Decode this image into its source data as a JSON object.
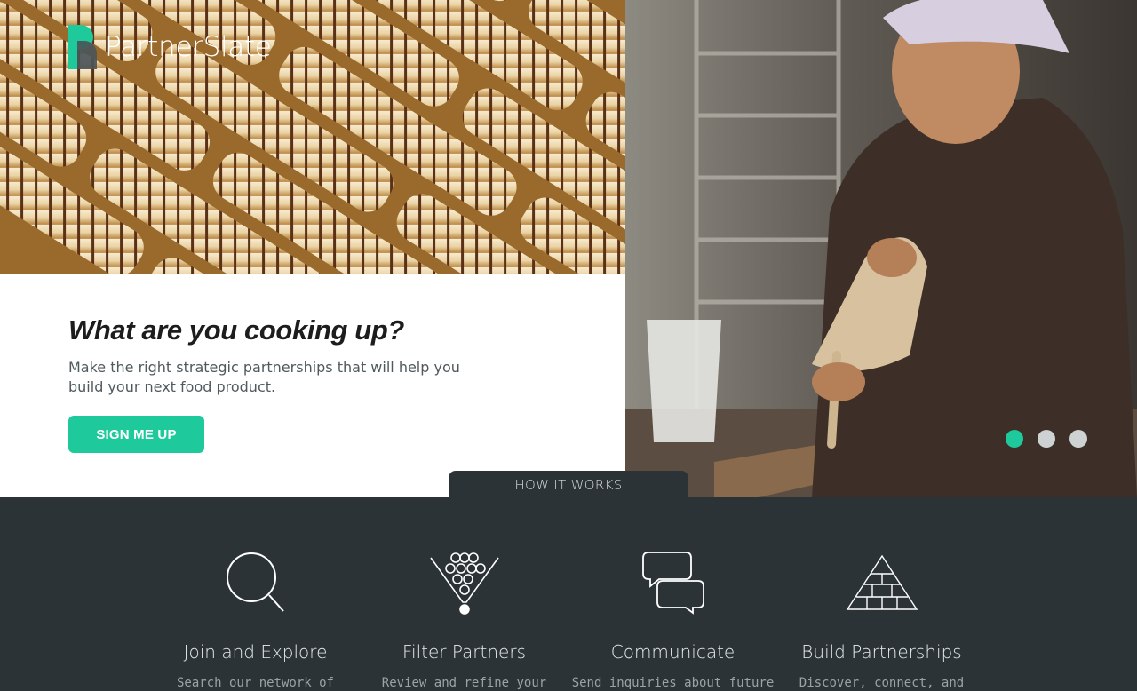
{
  "brand": {
    "name": "PartnerSlate",
    "accent": "#1ec99b",
    "dark": "#2c3337"
  },
  "hero": {
    "headline": "What are you cooking up?",
    "subcopy": "Make the right strategic partnerships that will help you build your next food product.",
    "cta_label": "SIGN ME UP",
    "carousel": {
      "slides": 3,
      "active": 1
    }
  },
  "how": {
    "tab_label": "HOW IT WORKS",
    "steps": [
      {
        "icon": "magnifier-icon",
        "title": "Join and Explore",
        "desc": "Search our network of"
      },
      {
        "icon": "funnel-filter-icon",
        "title": "Filter Partners",
        "desc": "Review and refine your"
      },
      {
        "icon": "chat-bubbles-icon",
        "title": "Communicate",
        "desc": "Send inquiries about future"
      },
      {
        "icon": "pyramid-icon",
        "title": "Build Partnerships",
        "desc": "Discover, connect, and"
      }
    ]
  }
}
